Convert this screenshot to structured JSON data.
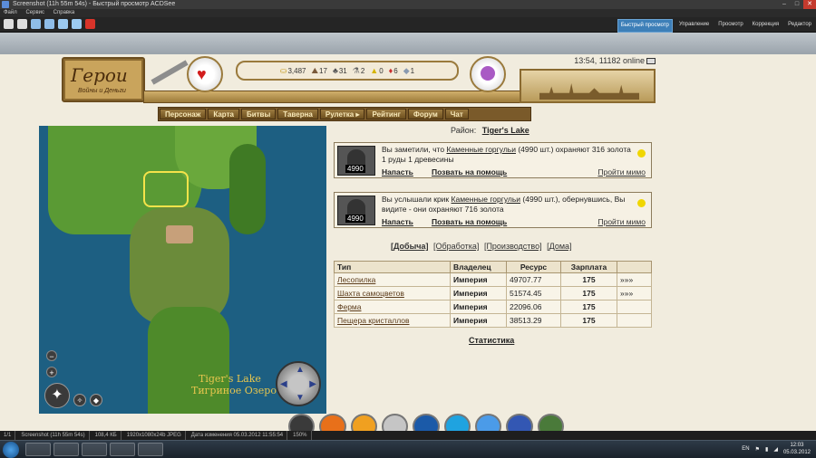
{
  "window": {
    "title": "Screenshot (11h 55m 54s) - Быстрый просмотр ACDSee",
    "menu": [
      "Файл",
      "Сервис",
      "Справка"
    ],
    "modes": [
      {
        "label": "Быстрый просмотр",
        "active": true
      },
      {
        "label": "Управление",
        "active": false
      },
      {
        "label": "Просмотр",
        "active": false
      },
      {
        "label": "Коррекция",
        "active": false
      },
      {
        "label": "Редактор",
        "active": false
      }
    ]
  },
  "game": {
    "logo_title": "Герои",
    "logo_subtitle": "Войны и Деньги",
    "resources": [
      {
        "icon": "gold-icon",
        "glyph": "⛀",
        "value": "3,487"
      },
      {
        "icon": "ore-icon",
        "glyph": "⛰",
        "value": "17"
      },
      {
        "icon": "wood-icon",
        "glyph": "♣",
        "value": "31"
      },
      {
        "icon": "mercury-icon",
        "glyph": "⚗",
        "value": "2"
      },
      {
        "icon": "sulfur-icon",
        "glyph": "▲",
        "value": "0"
      },
      {
        "icon": "crystal-icon",
        "glyph": "♦",
        "value": "6"
      },
      {
        "icon": "gem-icon",
        "glyph": "◆",
        "value": "1"
      }
    ],
    "online": "13:54, 11182 online",
    "nav": [
      "Персонаж",
      "Карта",
      "Битвы",
      "Таверна",
      "Рулетка ▸",
      "Рейтинг",
      "Форум",
      "Чат"
    ],
    "map": {
      "name_en": "Tiger's Lake",
      "name_ru": "Тигриное Озеро"
    },
    "region_label": "Район:",
    "region_name": "Tiger's Lake",
    "events": [
      {
        "count": "4990",
        "text_before": "Вы заметили, что ",
        "creature": "Каменные горгульи",
        "text_after": " (4990 шт.) охраняют 316 золота 1 руды 1 древесины",
        "attack": "Напасть",
        "help": "Позвать на помощь",
        "pass": "Пройти мимо"
      },
      {
        "count": "4990",
        "text_before": "Вы услышали крик ",
        "creature": "Каменные горгульи",
        "text_after": " (4990 шт.), обернувшись, Вы видите - они охраняют 716 золота",
        "attack": "Напасть",
        "help": "Позвать на помощь",
        "pass": "Пройти мимо"
      }
    ],
    "tabs": [
      "[Добыча]",
      "[Обработка]",
      "[Производство]",
      "[Дома]"
    ],
    "table": {
      "headers": [
        "Тип",
        "Владелец",
        "Ресурс",
        "Зарплата",
        ""
      ],
      "rows": [
        [
          "Лесопилка",
          "Империя",
          "49707.77",
          "175",
          "»»»"
        ],
        [
          "Шахта самоцветов",
          "Империя",
          "51574.45",
          "175",
          "»»»"
        ],
        [
          "Ферма",
          "Империя",
          "22096.06",
          "175",
          ""
        ],
        [
          "Пещера кристаллов",
          "Империя",
          "38513.29",
          "175",
          ""
        ]
      ]
    },
    "stats_link": "Статистика"
  },
  "statusbar": [
    "1/1",
    "Screenshot (11h 55m 54s)",
    "108,4 КБ",
    "1920x1080x24b JPEG",
    "Дата изменения 05.03.2012 11:55:54",
    "150%"
  ],
  "taskbar": {
    "lang": "EN",
    "time": "12:03",
    "date": "05.03.2012"
  }
}
